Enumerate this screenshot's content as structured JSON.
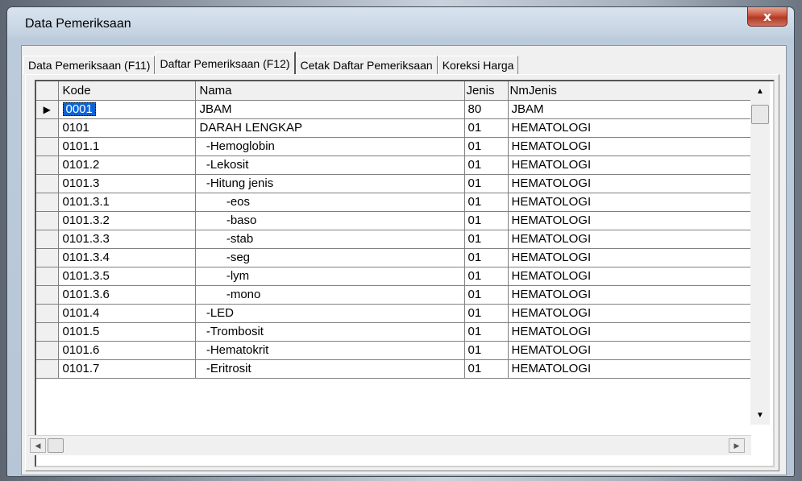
{
  "window": {
    "title": "Data Pemeriksaan",
    "close_glyph": "x"
  },
  "tabs": [
    {
      "label": "Data Pemeriksaan  (F11)"
    },
    {
      "label": "Daftar Pemeriksaan  (F12)"
    },
    {
      "label": "Cetak Daftar Pemeriksaan"
    },
    {
      "label": "Koreksi Harga"
    }
  ],
  "active_tab": "Daftar Pemeriksaan  (F12)",
  "grid": {
    "columns": [
      "Kode",
      "Nama",
      "Jenis",
      "NmJenis"
    ],
    "current_row_marker": "▶",
    "rows": [
      {
        "kode": "0001",
        "nama": "JBAM",
        "jenis": "80",
        "nmjenis": "JBAM"
      },
      {
        "kode": "0101",
        "nama": "DARAH LENGKAP",
        "jenis": "01",
        "nmjenis": "HEMATOLOGI"
      },
      {
        "kode": "0101.1",
        "nama": "  -Hemoglobin",
        "jenis": "01",
        "nmjenis": "HEMATOLOGI"
      },
      {
        "kode": "0101.2",
        "nama": "  -Lekosit",
        "jenis": "01",
        "nmjenis": "HEMATOLOGI"
      },
      {
        "kode": "0101.3",
        "nama": "  -Hitung jenis",
        "jenis": "01",
        "nmjenis": "HEMATOLOGI"
      },
      {
        "kode": "0101.3.1",
        "nama": "        -eos",
        "jenis": "01",
        "nmjenis": "HEMATOLOGI"
      },
      {
        "kode": "0101.3.2",
        "nama": "        -baso",
        "jenis": "01",
        "nmjenis": "HEMATOLOGI"
      },
      {
        "kode": "0101.3.3",
        "nama": "        -stab",
        "jenis": "01",
        "nmjenis": "HEMATOLOGI"
      },
      {
        "kode": "0101.3.4",
        "nama": "        -seg",
        "jenis": "01",
        "nmjenis": "HEMATOLOGI"
      },
      {
        "kode": "0101.3.5",
        "nama": "        -lym",
        "jenis": "01",
        "nmjenis": "HEMATOLOGI"
      },
      {
        "kode": "0101.3.6",
        "nama": "        -mono",
        "jenis": "01",
        "nmjenis": "HEMATOLOGI"
      },
      {
        "kode": "0101.4",
        "nama": "  -LED",
        "jenis": "01",
        "nmjenis": "HEMATOLOGI"
      },
      {
        "kode": "0101.5",
        "nama": "  -Trombosit",
        "jenis": "01",
        "nmjenis": "HEMATOLOGI"
      },
      {
        "kode": "0101.6",
        "nama": "  -Hematokrit",
        "jenis": "01",
        "nmjenis": "HEMATOLOGI"
      },
      {
        "kode": "0101.7",
        "nama": "  -Eritrosit",
        "jenis": "01",
        "nmjenis": "HEMATOLOGI"
      }
    ]
  },
  "scrollbar": {
    "up": "▲",
    "down": "▼",
    "left": "◀",
    "right": "▶"
  },
  "colors": {
    "selection": "#0a64d7",
    "close_button": "#c9513b"
  }
}
